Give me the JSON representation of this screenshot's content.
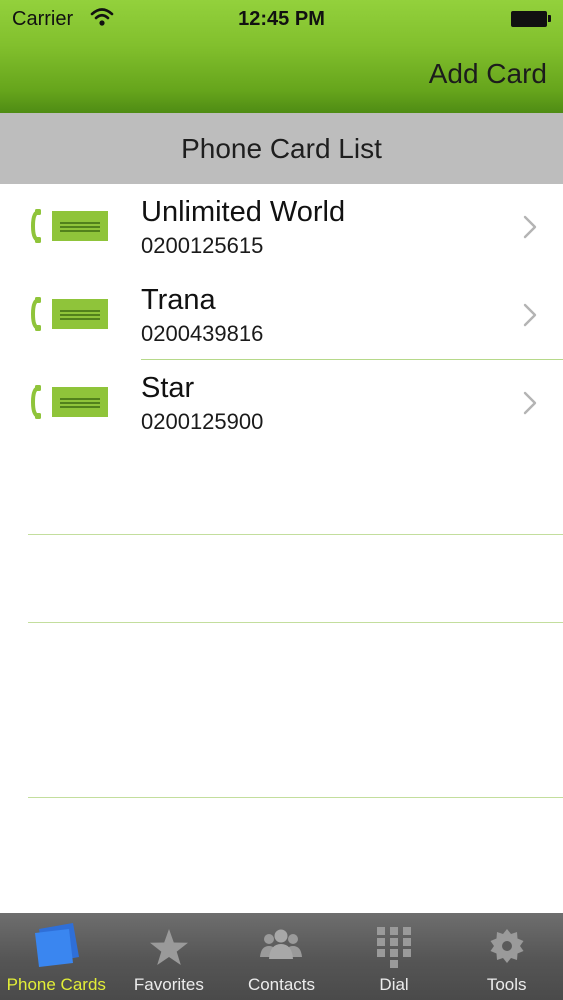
{
  "status_bar": {
    "carrier": "Carrier",
    "time": "12:45 PM"
  },
  "nav": {
    "add_card_label": "Add Card"
  },
  "section": {
    "title": "Phone Card List"
  },
  "cards": [
    {
      "name": "Unlimited World",
      "number": "0200125615"
    },
    {
      "name": "Trana",
      "number": "0200439816"
    },
    {
      "name": "Star",
      "number": "0200125900"
    }
  ],
  "tabs": [
    {
      "label": "Phone Cards",
      "icon": "phone-cards-icon",
      "active": true
    },
    {
      "label": "Favorites",
      "icon": "star-icon",
      "active": false
    },
    {
      "label": "Contacts",
      "icon": "contacts-icon",
      "active": false
    },
    {
      "label": "Dial",
      "icon": "dialpad-icon",
      "active": false
    },
    {
      "label": "Tools",
      "icon": "gear-icon",
      "active": false
    }
  ],
  "colors": {
    "header_green": "#82c02d",
    "accent_green": "#8fc43a",
    "active_tab": "#e2ee37",
    "section_gray": "#bdbdbd",
    "tab_bar_gray": "#555555"
  }
}
